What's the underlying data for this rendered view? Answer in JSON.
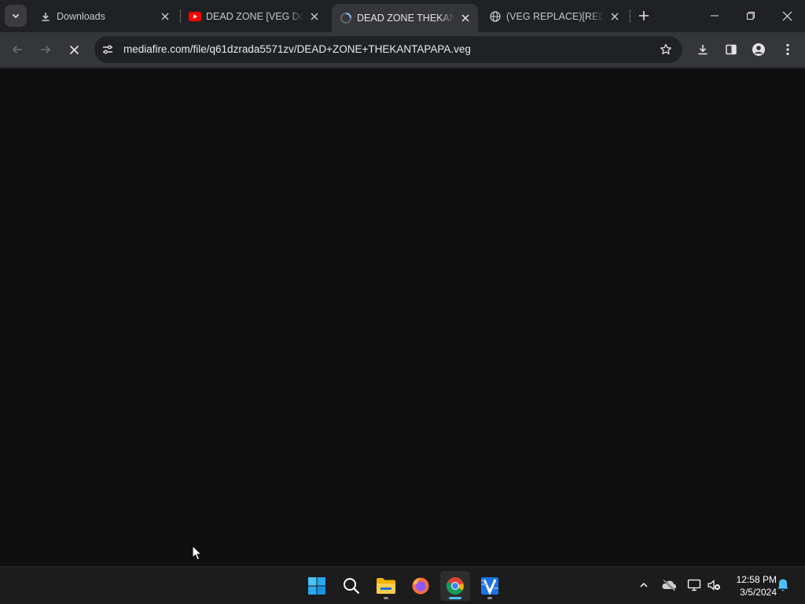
{
  "tabs": [
    {
      "title": "Downloads",
      "icon": "download-icon",
      "active": false
    },
    {
      "title": "DEAD ZONE [VEG Download]",
      "icon": "youtube-icon",
      "active": false
    },
    {
      "title": "DEAD ZONE THEKANTAPAPA",
      "icon": "loading-spinner-icon",
      "active": true
    },
    {
      "title": "(VEG REPLACE)[RED ZONE]",
      "icon": "globe-icon",
      "active": false
    }
  ],
  "address_bar": {
    "url": "mediafire.com/file/q61dzrada5571zv/DEAD+ZONE+THEKANTAPAPA.veg"
  },
  "taskbar": {
    "apps": [
      "start-button",
      "search",
      "file-explorer",
      "firefox",
      "chrome",
      "vegas-pro"
    ],
    "time": "12:58 PM",
    "date": "3/5/2024"
  },
  "colors": {
    "tabstrip": "#202124",
    "toolbar": "#35363a",
    "page_background": "#0f0f10",
    "taskbar": "#1c1c1c",
    "accent": "#4cc2ff"
  }
}
